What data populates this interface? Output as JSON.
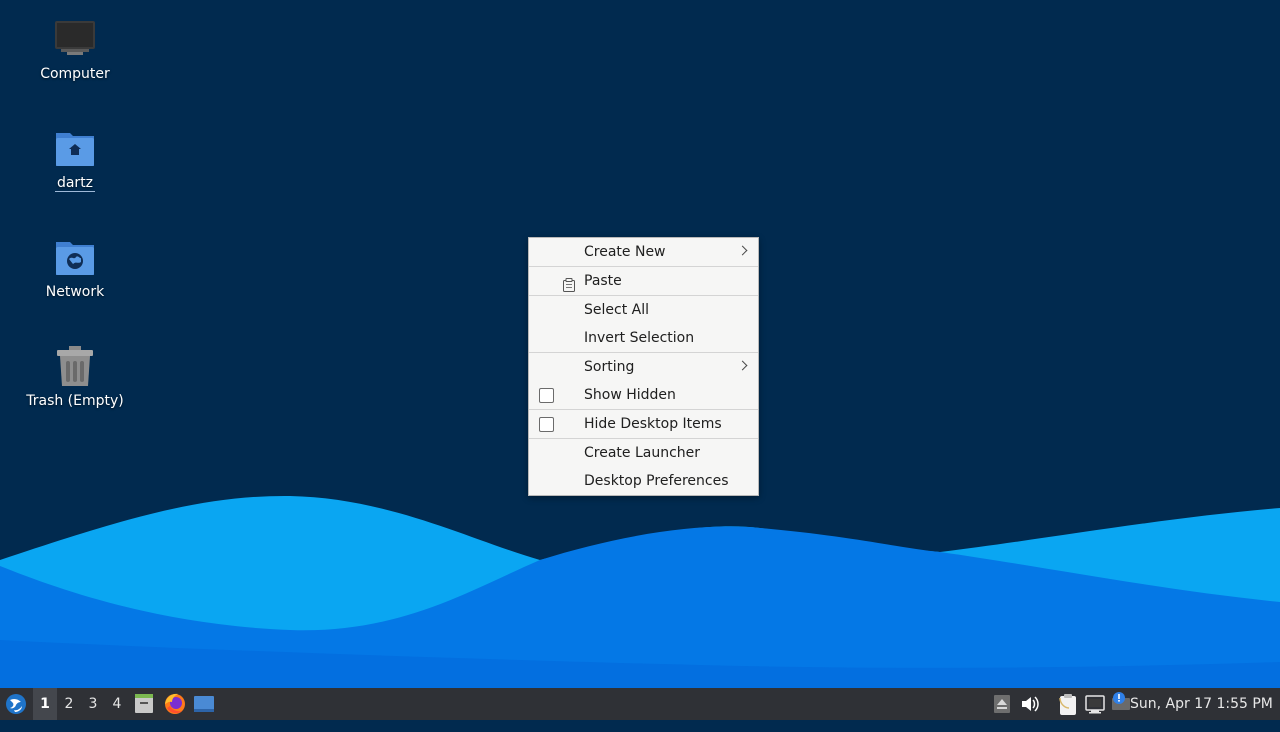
{
  "desktop": {
    "icons": [
      {
        "label": "Computer",
        "icon": "monitor-icon"
      },
      {
        "label": "dartz",
        "icon": "home-folder-icon"
      },
      {
        "label": "Network",
        "icon": "network-folder-icon"
      },
      {
        "label": "Trash (Empty)",
        "icon": "trash-icon"
      }
    ]
  },
  "context_menu": {
    "create_new": "Create New",
    "paste": "Paste",
    "select_all": "Select All",
    "invert_selection": "Invert Selection",
    "sorting": "Sorting",
    "show_hidden": "Show Hidden",
    "show_hidden_checked": false,
    "hide_desktop_items": "Hide Desktop Items",
    "hide_desktop_items_checked": false,
    "create_launcher": "Create Launcher",
    "desktop_preferences": "Desktop Preferences"
  },
  "taskbar": {
    "workspaces": [
      "1",
      "2",
      "3",
      "4"
    ],
    "active_workspace": "1",
    "launchers": [
      "file-manager-icon",
      "firefox-icon",
      "show-desktop-icon"
    ],
    "tray": [
      "eject-icon",
      "volume-icon",
      "clipboard-icon",
      "network-monitor-icon",
      "notification-icon"
    ],
    "clock": "Sun, Apr 17  1:55 PM"
  },
  "colors": {
    "desktop_bg": "#012a4f",
    "wave_light": "#0aa6f2",
    "wave_dark": "#0470e0",
    "menu_bg": "#f6f6f5",
    "taskbar_bg": "#2f3136"
  }
}
